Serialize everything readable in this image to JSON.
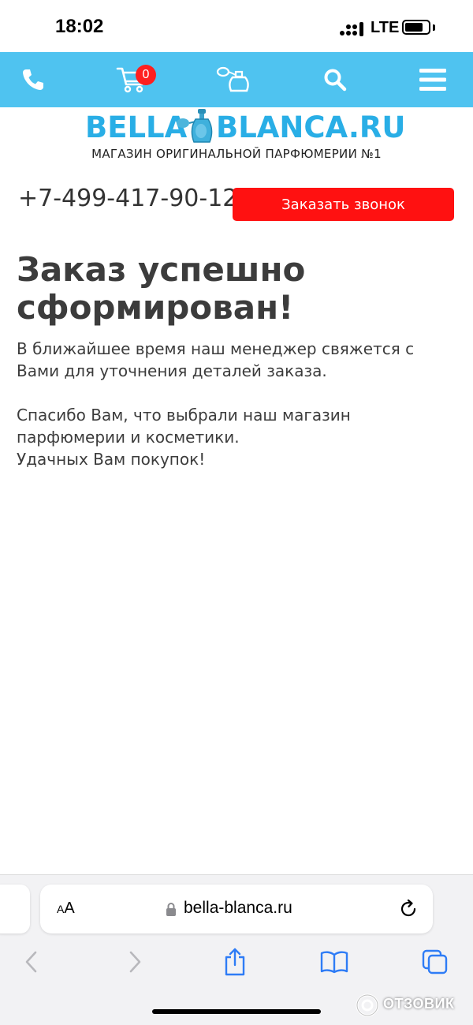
{
  "status_bar": {
    "time": "18:02",
    "network": "LTE"
  },
  "nav": {
    "cart_count": "0"
  },
  "logo": {
    "left": "BELLA",
    "right": "BLANCA.RU",
    "tagline": "МАГАЗИН ОРИГИНАЛЬНОЙ ПАРФЮМЕРИИ №1"
  },
  "contact": {
    "phone": "+7-499-417-90-12",
    "callback_label": "Заказать звонок"
  },
  "main": {
    "heading_line1": "Заказ успешно",
    "heading_line2": "сформирован!",
    "p1_line1": "В ближайшее время наш менеджер свяжется с",
    "p1_line2": "Вами для уточнения деталей заказа.",
    "p2_line1": "Спасибо Вам, что выбрали наш магазин",
    "p2_line2": "парфюмерии и косметики.",
    "p2_line3": "Удачных Вам покупок!"
  },
  "browser": {
    "aa_small": "A",
    "aa_large": "A",
    "url": "bella-blanca.ru"
  },
  "watermark": {
    "text": "ОТЗОВИК"
  },
  "colors": {
    "nav_bg": "#4fc3f0",
    "accent_red": "#ff1111",
    "logo_blue": "#29aee6",
    "text": "#3c3c3c"
  }
}
